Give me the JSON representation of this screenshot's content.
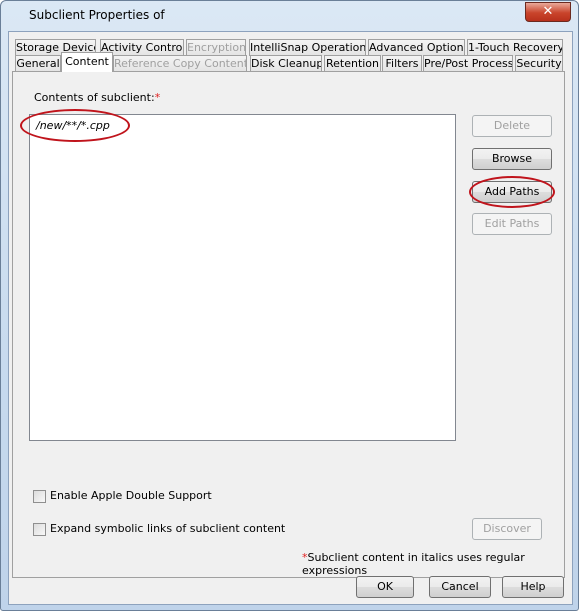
{
  "window": {
    "title": "Subclient Properties of",
    "close_icon": "close-icon"
  },
  "tabs_row1": [
    {
      "label": "Storage Device",
      "enabled": true
    },
    {
      "label": "Activity Control",
      "enabled": true
    },
    {
      "label": "Encryption",
      "enabled": false
    },
    {
      "label": "IntelliSnap Operations",
      "enabled": true
    },
    {
      "label": "Advanced Options",
      "enabled": true
    },
    {
      "label": "1-Touch Recovery",
      "enabled": true
    }
  ],
  "tabs_row2": [
    {
      "label": "General",
      "enabled": true
    },
    {
      "label": "Content",
      "enabled": true,
      "selected": true
    },
    {
      "label": "Reference Copy Contents",
      "enabled": false
    },
    {
      "label": "Disk Cleanup",
      "enabled": true
    },
    {
      "label": "Retention",
      "enabled": true
    },
    {
      "label": "Filters",
      "enabled": true
    },
    {
      "label": "Pre/Post Process",
      "enabled": true
    },
    {
      "label": "Security",
      "enabled": true
    }
  ],
  "content": {
    "label": "Contents of subclient:",
    "required_mark": "*",
    "items": [
      "/new/**/*.cpp"
    ],
    "buttons": {
      "delete": "Delete",
      "browse": "Browse",
      "add_paths": "Add Paths",
      "edit_paths": "Edit Paths",
      "discover": "Discover"
    },
    "apple_double": {
      "label": "Enable Apple Double Support",
      "checked": false
    },
    "expand_links": {
      "label": "Expand symbolic links of subclient content",
      "checked": false
    },
    "footnote_mark": "*",
    "footnote": "Subclient content in italics uses regular expressions"
  },
  "footer": {
    "ok": "OK",
    "cancel": "Cancel",
    "help": "Help"
  },
  "colors": {
    "highlight": "#c0141c",
    "required": "#e02020"
  }
}
